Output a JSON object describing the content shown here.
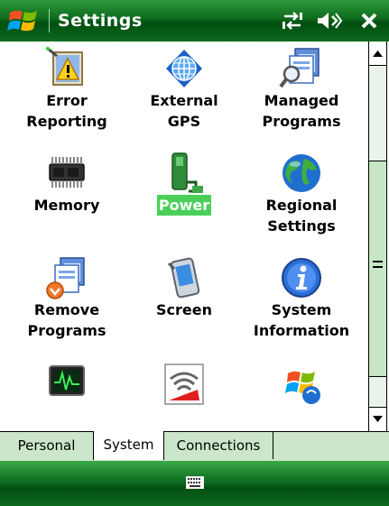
{
  "window": {
    "title": "Settings"
  },
  "items": [
    {
      "label": "Error\nReporting",
      "icon": "error-reporting-icon",
      "selected": false
    },
    {
      "label": "External\nGPS",
      "icon": "external-gps-icon",
      "selected": false
    },
    {
      "label": "Managed\nPrograms",
      "icon": "managed-programs-icon",
      "selected": false
    },
    {
      "label": "Memory",
      "icon": "memory-icon",
      "selected": false
    },
    {
      "label": "Power",
      "icon": "power-icon",
      "selected": true
    },
    {
      "label": "Regional\nSettings",
      "icon": "regional-settings-icon",
      "selected": false
    },
    {
      "label": "Remove\nPrograms",
      "icon": "remove-programs-icon",
      "selected": false
    },
    {
      "label": "Screen",
      "icon": "screen-icon",
      "selected": false
    },
    {
      "label": "System\nInformation",
      "icon": "system-information-icon",
      "selected": false
    },
    {
      "label": "",
      "icon": "task-manager-icon",
      "selected": false
    },
    {
      "label": "",
      "icon": "wifi-icon",
      "selected": false
    },
    {
      "label": "",
      "icon": "windows-update-icon",
      "selected": false
    }
  ],
  "tabs": [
    {
      "label": "Personal",
      "active": false
    },
    {
      "label": "System",
      "active": true
    },
    {
      "label": "Connections",
      "active": false
    }
  ],
  "colors": {
    "titlebar": "#0d6a1d",
    "selection": "#4ad05a",
    "tabstrip": "#cbe6cb"
  }
}
